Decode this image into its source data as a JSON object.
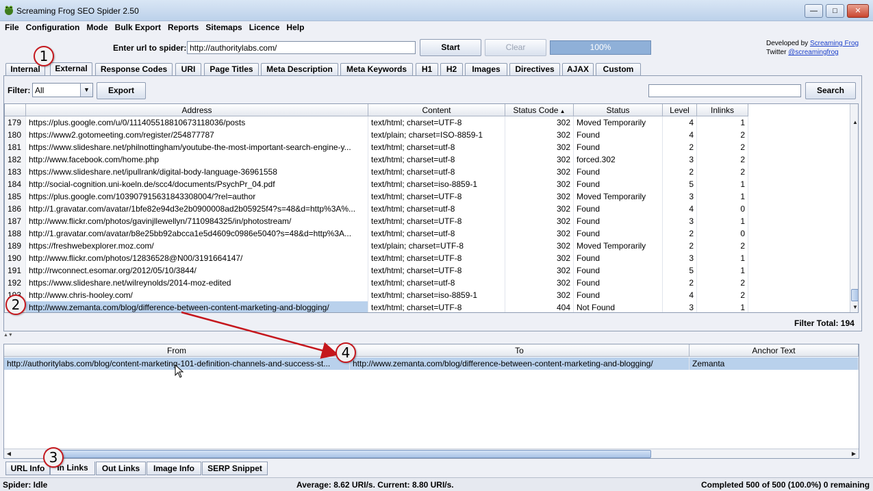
{
  "window": {
    "title": "Screaming Frog SEO Spider 2.50"
  },
  "menu": [
    "File",
    "Configuration",
    "Mode",
    "Bulk Export",
    "Reports",
    "Sitemaps",
    "Licence",
    "Help"
  ],
  "url_bar": {
    "label": "Enter url to spider:",
    "value": "http://authoritylabs.com/",
    "start": "Start",
    "clear": "Clear",
    "progress_text": "100%",
    "progress": 1.0
  },
  "credits": {
    "developed_by": "Developed by",
    "developer_link": "Screaming Frog",
    "twitter": "Twitter",
    "twitter_link": "@screamingfrog"
  },
  "tabs": [
    "Internal",
    "External",
    "Response Codes",
    "URI",
    "Page Titles",
    "Meta Description",
    "Meta Keywords",
    "H1",
    "H2",
    "Images",
    "Directives",
    "AJAX",
    "Custom"
  ],
  "active_tab": "External",
  "filter": {
    "label": "Filter:",
    "value": "All",
    "export": "Export",
    "search": "Search",
    "search_value": ""
  },
  "table": {
    "columns": [
      "Address",
      "Content",
      "Status Code",
      "Status",
      "Level",
      "Inlinks"
    ],
    "rows": [
      {
        "n": "179",
        "address": "https://plus.google.com/u/0/111405518810673118036/posts",
        "content": "text/html; charset=UTF-8",
        "code": "302",
        "status": "Moved Temporarily",
        "level": "4",
        "inlinks": "1"
      },
      {
        "n": "180",
        "address": "https://www2.gotomeeting.com/register/254877787",
        "content": "text/plain; charset=ISO-8859-1",
        "code": "302",
        "status": "Found",
        "level": "4",
        "inlinks": "2"
      },
      {
        "n": "181",
        "address": "https://www.slideshare.net/philnottingham/youtube-the-most-important-search-engine-y...",
        "content": "text/html; charset=utf-8",
        "code": "302",
        "status": "Found",
        "level": "2",
        "inlinks": "2"
      },
      {
        "n": "182",
        "address": "http://www.facebook.com/home.php",
        "content": "text/html; charset=utf-8",
        "code": "302",
        "status": "forced.302",
        "level": "3",
        "inlinks": "2"
      },
      {
        "n": "183",
        "address": "https://www.slideshare.net/ipullrank/digital-body-language-36961558",
        "content": "text/html; charset=utf-8",
        "code": "302",
        "status": "Found",
        "level": "2",
        "inlinks": "2"
      },
      {
        "n": "184",
        "address": "http://social-cognition.uni-koeln.de/scc4/documents/PsychPr_04.pdf",
        "content": "text/html; charset=iso-8859-1",
        "code": "302",
        "status": "Found",
        "level": "5",
        "inlinks": "1"
      },
      {
        "n": "185",
        "address": "https://plus.google.com/103907915631843308004/?rel=author",
        "content": "text/html; charset=UTF-8",
        "code": "302",
        "status": "Moved Temporarily",
        "level": "3",
        "inlinks": "1"
      },
      {
        "n": "186",
        "address": "http://1.gravatar.com/avatar/1bfe82e94d3e2b0900008ad2b05925f4?s=48&d=http%3A%...",
        "content": "text/html; charset=utf-8",
        "code": "302",
        "status": "Found",
        "level": "4",
        "inlinks": "0"
      },
      {
        "n": "187",
        "address": "http://www.flickr.com/photos/gavinjllewellyn/7110984325/in/photostream/",
        "content": "text/html; charset=UTF-8",
        "code": "302",
        "status": "Found",
        "level": "3",
        "inlinks": "1"
      },
      {
        "n": "188",
        "address": "http://1.gravatar.com/avatar/b8e25bb92abcca1e5d4609c0986e5040?s=48&d=http%3A...",
        "content": "text/html; charset=utf-8",
        "code": "302",
        "status": "Found",
        "level": "2",
        "inlinks": "0"
      },
      {
        "n": "189",
        "address": "https://freshwebexplorer.moz.com/",
        "content": "text/plain; charset=UTF-8",
        "code": "302",
        "status": "Moved Temporarily",
        "level": "2",
        "inlinks": "2"
      },
      {
        "n": "190",
        "address": "http://www.flickr.com/photos/12836528@N00/3191664147/",
        "content": "text/html; charset=UTF-8",
        "code": "302",
        "status": "Found",
        "level": "3",
        "inlinks": "1"
      },
      {
        "n": "191",
        "address": "http://rwconnect.esomar.org/2012/05/10/3844/",
        "content": "text/html; charset=UTF-8",
        "code": "302",
        "status": "Found",
        "level": "5",
        "inlinks": "1"
      },
      {
        "n": "192",
        "address": "https://www.slideshare.net/wilreynolds/2014-moz-edited",
        "content": "text/html; charset=utf-8",
        "code": "302",
        "status": "Found",
        "level": "2",
        "inlinks": "2"
      },
      {
        "n": "193",
        "address": "http://www.chris-hooley.com/",
        "content": "text/html; charset=iso-8859-1",
        "code": "302",
        "status": "Found",
        "level": "4",
        "inlinks": "2"
      },
      {
        "n": "194",
        "address": "http://www.zemanta.com/blog/difference-between-content-marketing-and-blogging/",
        "content": "text/html; charset=UTF-8",
        "code": "404",
        "status": "Not Found",
        "level": "3",
        "inlinks": "1"
      }
    ],
    "filter_total_label": "Filter Total:",
    "filter_total": "194"
  },
  "links_table": {
    "columns": [
      "From",
      "To",
      "Anchor Text"
    ],
    "rows": [
      {
        "from": "http://authoritylabs.com/blog/content-marketing-101-definition-channels-and-success-st...",
        "to": "http://www.zemanta.com/blog/difference-between-content-marketing-and-blogging/",
        "anchor": "Zemanta"
      }
    ]
  },
  "bottom_tabs": [
    "URL Info",
    "In Links",
    "Out Links",
    "Image Info",
    "SERP Snippet"
  ],
  "active_bottom_tab": "In Links",
  "status": {
    "left": "Spider: Idle",
    "center": "Average: 8.62 URI/s. Current: 8.80 URI/s.",
    "right": "Completed 500 of 500 (100.0%) 0 remaining"
  },
  "markers": [
    "1",
    "2",
    "3",
    "4"
  ],
  "colors": {
    "selection": "#b9d1ec",
    "marker_border": "#c5171d",
    "arrow": "#c5171d",
    "link": "#1a3ec9"
  }
}
